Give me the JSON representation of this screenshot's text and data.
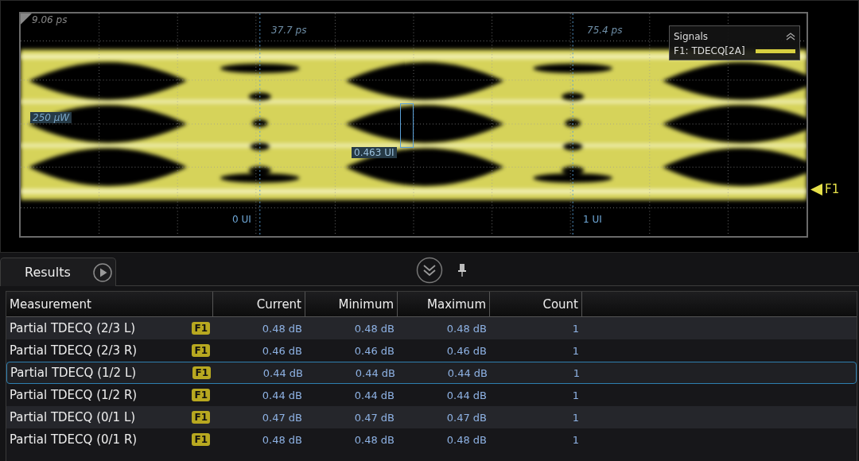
{
  "scope": {
    "corner_label": "9.06 ps",
    "time_markers": [
      "37.7 ps",
      "75.4 ps"
    ],
    "level_label": "250 µW",
    "ui_markers": [
      "0 UI",
      "1 UI"
    ],
    "cursor_label": "0.463 UI",
    "legend": {
      "title": "Signals",
      "entries": [
        {
          "label": "F1: TDECQ[2A]",
          "color": "#d8d040"
        }
      ]
    },
    "trace_marker": "F1"
  },
  "results": {
    "tabs": [
      {
        "label": "Results",
        "selected": true
      }
    ],
    "columns": [
      "Measurement",
      "Current",
      "Minimum",
      "Maximum",
      "Count"
    ],
    "rows": [
      {
        "measurement": "Partial TDECQ (2/3 L)",
        "source": "F1",
        "current": "0.48 dB",
        "minimum": "0.48 dB",
        "maximum": "0.48 dB",
        "count": "1",
        "selected": false
      },
      {
        "measurement": "Partial TDECQ (2/3 R)",
        "source": "F1",
        "current": "0.46 dB",
        "minimum": "0.46 dB",
        "maximum": "0.46 dB",
        "count": "1",
        "selected": false
      },
      {
        "measurement": "Partial TDECQ (1/2 L)",
        "source": "F1",
        "current": "0.44 dB",
        "minimum": "0.44 dB",
        "maximum": "0.44 dB",
        "count": "1",
        "selected": true
      },
      {
        "measurement": "Partial TDECQ (1/2 R)",
        "source": "F1",
        "current": "0.44 dB",
        "minimum": "0.44 dB",
        "maximum": "0.44 dB",
        "count": "1",
        "selected": false
      },
      {
        "measurement": "Partial TDECQ (0/1 L)",
        "source": "F1",
        "current": "0.47 dB",
        "minimum": "0.47 dB",
        "maximum": "0.47 dB",
        "count": "1",
        "selected": false
      },
      {
        "measurement": "Partial TDECQ (0/1 R)",
        "source": "F1",
        "current": "0.48 dB",
        "minimum": "0.48 dB",
        "maximum": "0.48 dB",
        "count": "1",
        "selected": false
      }
    ]
  }
}
